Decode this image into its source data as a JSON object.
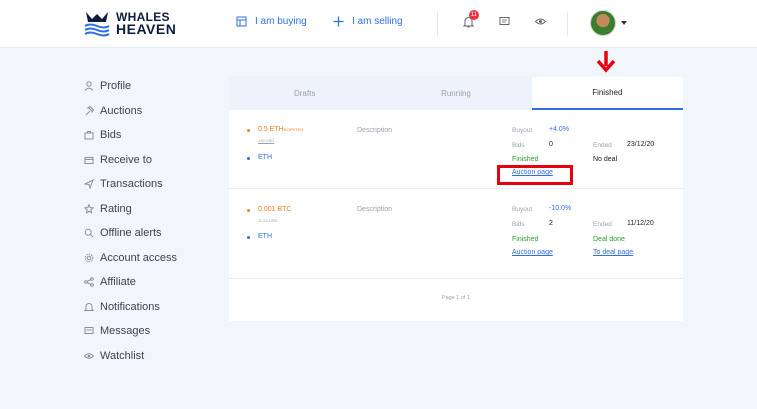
{
  "logo": {
    "line1": "WHALES",
    "line2": "HEAVEN"
  },
  "header": {
    "buying_label": "I am buying",
    "selling_label": "I am selling",
    "notification_count": "11"
  },
  "sidebar": {
    "items": [
      {
        "label": "Profile",
        "icon": "user-icon"
      },
      {
        "label": "Auctions",
        "icon": "hammer-icon"
      },
      {
        "label": "Bids",
        "icon": "briefcase-icon"
      },
      {
        "label": "Receive to",
        "icon": "wallet-icon"
      },
      {
        "label": "Transactions",
        "icon": "send-icon"
      },
      {
        "label": "Rating",
        "icon": "star-icon"
      },
      {
        "label": "Offline alerts",
        "icon": "search-icon"
      },
      {
        "label": "Account access",
        "icon": "gear-icon"
      },
      {
        "label": "Affiliate",
        "icon": "share-icon"
      },
      {
        "label": "Notifications",
        "icon": "bell-icon"
      },
      {
        "label": "Messages",
        "icon": "chat-icon"
      },
      {
        "label": "Watchlist",
        "icon": "eye-icon"
      }
    ]
  },
  "tabs": [
    {
      "label": "Drafts"
    },
    {
      "label": "Running"
    },
    {
      "label": "Finished"
    }
  ],
  "auctions": [
    {
      "amount": "0.5 ETH",
      "network": "ROPSTEN",
      "usd": "195 USD",
      "currency": "ETH",
      "description": "Description",
      "buyout_label": "Buyout",
      "buyout_value": "+4.0%",
      "bids_label": "Bids",
      "bids_value": "0",
      "ended_label": "Ended",
      "ended_value": "23/12/20",
      "status": "Finished",
      "deal": "No deal",
      "auction_link": "Auction page"
    },
    {
      "amount": "0.001 BTC",
      "network": "",
      "usd": "11.53 USD",
      "currency": "ETH",
      "description": "Description",
      "buyout_label": "Buyout",
      "buyout_value": "-10.0%",
      "bids_label": "Bids",
      "bids_value": "2",
      "ended_label": "Ended",
      "ended_value": "11/12/20",
      "status": "Finished",
      "deal": "Deal done",
      "auction_link": "Auction page",
      "deal_link": "To deal page"
    }
  ],
  "pagination": {
    "text": "Page 1 of 1"
  },
  "colors": {
    "accent": "#2f6fe0",
    "highlight": "#e8000d",
    "success": "#2e9b2e",
    "crypto": "#f07c1e"
  }
}
